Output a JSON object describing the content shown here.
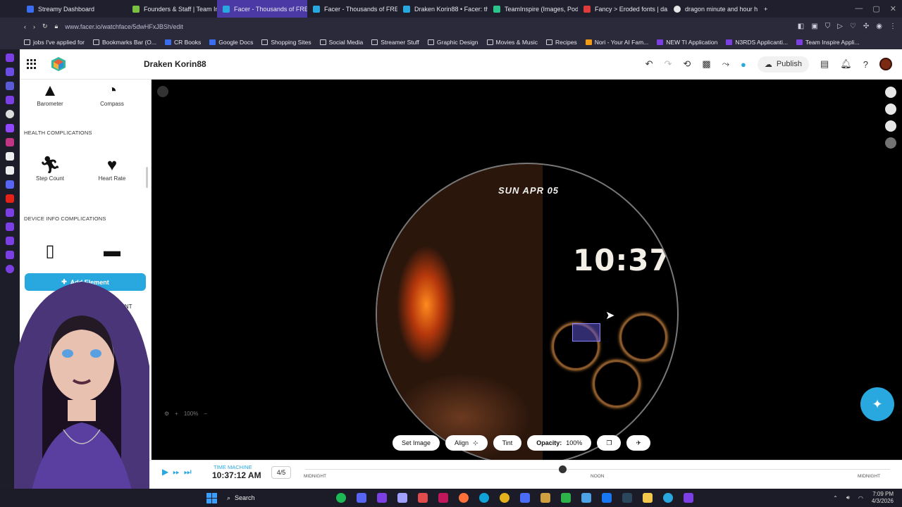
{
  "browser": {
    "tabs": [
      {
        "label": "Streamy Dashboard",
        "color": "#3a6df0"
      },
      {
        "label": "Founders & Staff | Team In",
        "color": "#7bc043"
      },
      {
        "label": "Facer - Thousands of FRE",
        "color": "#29a8e0",
        "active": true
      },
      {
        "label": "Facer - Thousands of FRE",
        "color": "#29a8e0"
      },
      {
        "label": "Draken Korin88 • Facer: th",
        "color": "#29a8e0"
      },
      {
        "label": "TeamInspire (Images, Pod",
        "color": "#2cc48a"
      },
      {
        "label": "Fancy > Eroded fonts | da",
        "color": "#e03b3b"
      },
      {
        "label": "dragon minute and hour h",
        "color": "#e6e6e6"
      }
    ],
    "new_tab": "+",
    "url": "www.facer.io/watchface/5dwHFxJBSh/edit",
    "bookmarks": [
      "jobs I've applied for",
      "Bookmarks Bar (O...",
      "CR Books",
      "Google Docs",
      "Shopping Sites",
      "Social Media",
      "Streamer Stuff",
      "Graphic Design",
      "Movies & Music",
      "Recipes",
      "Nori - Your AI Fam...",
      "NEW TI Application",
      "N3RDS Applicanti...",
      "Team Inspire Appli..."
    ]
  },
  "app": {
    "title": "Draken Korin88",
    "publish_label": "Publish"
  },
  "left_panel": {
    "top_items": [
      {
        "label": "Barometer",
        "icon": "barometer-icon"
      },
      {
        "label": "Compass",
        "icon": "compass-icon"
      }
    ],
    "health_title": "HEALTH COMPLICATIONS",
    "health_items": [
      {
        "label": "Step Count",
        "icon": "running-icon"
      },
      {
        "label": "Heart Rate",
        "icon": "heart-icon"
      }
    ],
    "device_title": "DEVICE INFO COMPLICATIONS",
    "add_element_label": "Add Element",
    "ambient_label": "AMBIENT"
  },
  "canvas": {
    "zoom_label": "100%",
    "watch": {
      "date_text": "SUN APR 05",
      "time_text": "10:37"
    }
  },
  "bottom_tools": {
    "set_image": "Set Image",
    "align": "Align",
    "tint": "Tint",
    "opacity_label": "Opacity:",
    "opacity_value": "100%"
  },
  "timeline": {
    "label": "TIME MACHINE",
    "time": "10:37:12 AM",
    "fraction": "4/5",
    "left_mark": "MIDNIGHT",
    "mid_mark": "NOON",
    "right_mark": "MIDNIGHT",
    "position": 0.44
  },
  "taskbar": {
    "search_label": "Search",
    "time": "7:09 PM",
    "date": "4/3/2026"
  }
}
